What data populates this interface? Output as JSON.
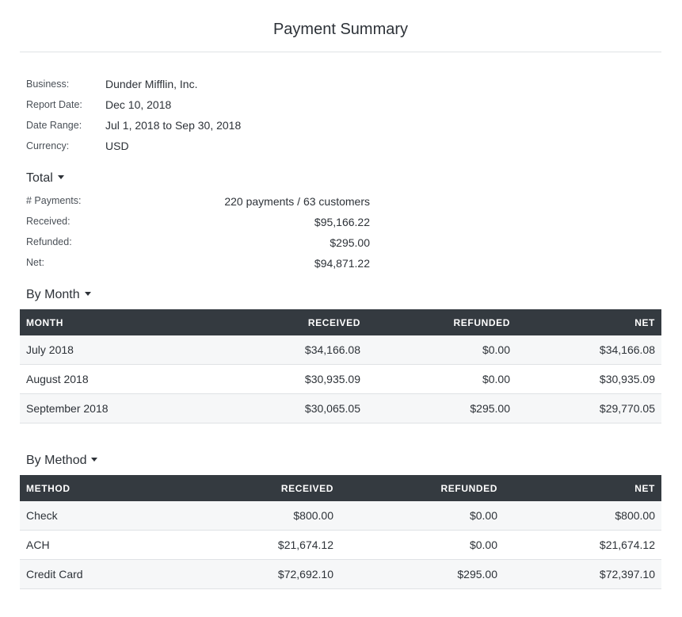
{
  "title": "Payment Summary",
  "info": [
    {
      "label": "Business:",
      "value": "Dunder Mifflin, Inc."
    },
    {
      "label": "Report Date:",
      "value": "Dec 10, 2018"
    },
    {
      "label": "Date Range:",
      "value": "Jul 1, 2018 to Sep 30, 2018"
    },
    {
      "label": "Currency:",
      "value": "USD"
    }
  ],
  "total": {
    "heading": "Total",
    "rows": [
      {
        "label": "# Payments:",
        "value": "220 payments / 63 customers"
      },
      {
        "label": "Received:",
        "value": "$95,166.22"
      },
      {
        "label": "Refunded:",
        "value": "$295.00"
      },
      {
        "label": "Net:",
        "value": "$94,871.22"
      }
    ]
  },
  "by_month": {
    "heading": "By Month",
    "columns": [
      "MONTH",
      "RECEIVED",
      "REFUNDED",
      "NET"
    ],
    "rows": [
      [
        "July 2018",
        "$34,166.08",
        "$0.00",
        "$34,166.08"
      ],
      [
        "August 2018",
        "$30,935.09",
        "$0.00",
        "$30,935.09"
      ],
      [
        "September 2018",
        "$30,065.05",
        "$295.00",
        "$29,770.05"
      ]
    ]
  },
  "by_method": {
    "heading": "By Method",
    "columns": [
      "METHOD",
      "RECEIVED",
      "REFUNDED",
      "NET"
    ],
    "rows": [
      [
        "Check",
        "$800.00",
        "$0.00",
        "$800.00"
      ],
      [
        "ACH",
        "$21,674.12",
        "$0.00",
        "$21,674.12"
      ],
      [
        "Credit Card",
        "$72,692.10",
        "$295.00",
        "$72,397.10"
      ]
    ]
  }
}
